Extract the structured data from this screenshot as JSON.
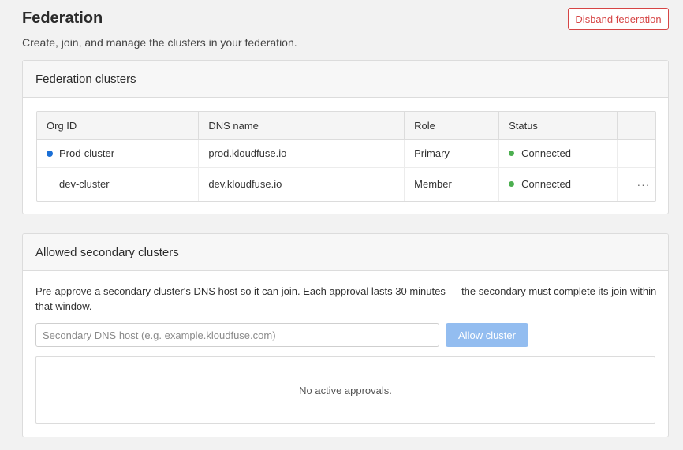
{
  "page": {
    "title": "Federation",
    "subtitle": "Create, join, and manage the clusters in your federation.",
    "disband_label": "Disband federation"
  },
  "clusters": {
    "title": "Federation clusters",
    "columns": [
      "Org ID",
      "DNS name",
      "Role",
      "Status",
      ""
    ],
    "rows": [
      {
        "org_id": "Prod-cluster",
        "dns": "prod.kloudfuse.io",
        "role": "Primary",
        "status": "Connected",
        "primary": true
      },
      {
        "org_id": "dev-cluster",
        "dns": "dev.kloudfuse.io",
        "role": "Member",
        "status": "Connected",
        "primary": false,
        "actions": "···"
      }
    ]
  },
  "secondary": {
    "title": "Allowed secondary clusters",
    "description": "Pre-approve a secondary cluster's DNS host so it can join. Each approval lasts 30 minutes — the secondary must complete its join within that window.",
    "input_value": "",
    "input_placeholder": "Secondary DNS host (e.g. example.kloudfuse.com)",
    "allow_label": "Allow cluster",
    "empty_text": "No active approvals."
  },
  "colors": {
    "danger": "#d64545",
    "primary_dot": "#1a6fd6",
    "connected": "#4caf50",
    "button_disabled": "#93bdf0"
  }
}
